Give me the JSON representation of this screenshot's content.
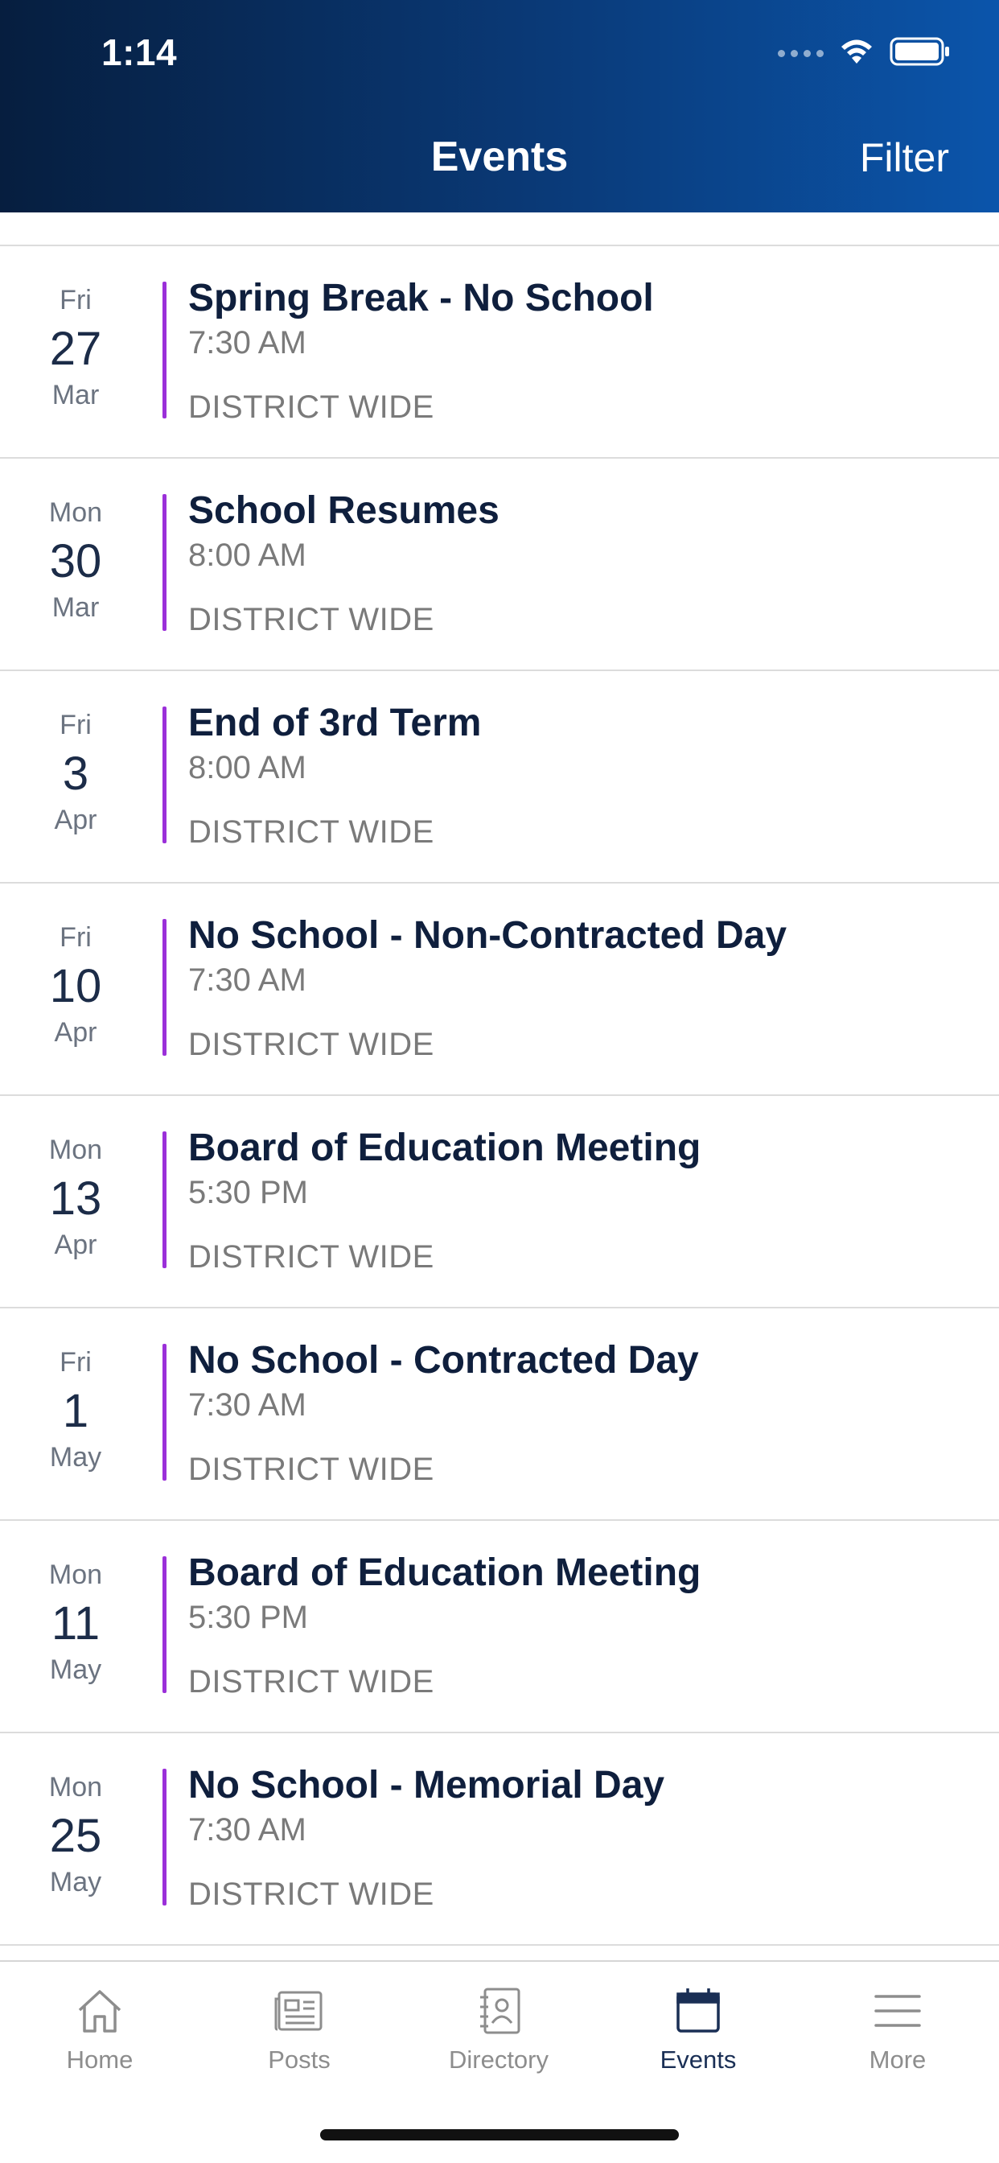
{
  "status_bar": {
    "time": "1:14"
  },
  "header": {
    "title": "Events",
    "filter_label": "Filter"
  },
  "events": [
    {
      "dow": "Fri",
      "day": "27",
      "month": "Mar",
      "title": "Spring Break - No School",
      "time": "7:30 AM",
      "location": "DISTRICT WIDE"
    },
    {
      "dow": "Mon",
      "day": "30",
      "month": "Mar",
      "title": "School Resumes",
      "time": "8:00 AM",
      "location": "DISTRICT WIDE"
    },
    {
      "dow": "Fri",
      "day": "3",
      "month": "Apr",
      "title": "End of 3rd Term",
      "time": "8:00 AM",
      "location": "DISTRICT WIDE"
    },
    {
      "dow": "Fri",
      "day": "10",
      "month": "Apr",
      "title": "No School - Non-Contracted Day",
      "time": "7:30 AM",
      "location": "DISTRICT WIDE"
    },
    {
      "dow": "Mon",
      "day": "13",
      "month": "Apr",
      "title": "Board of Education Meeting",
      "time": "5:30 PM",
      "location": "DISTRICT WIDE"
    },
    {
      "dow": "Fri",
      "day": "1",
      "month": "May",
      "title": "No School - Contracted Day",
      "time": "7:30 AM",
      "location": "DISTRICT WIDE"
    },
    {
      "dow": "Mon",
      "day": "11",
      "month": "May",
      "title": "Board of Education Meeting",
      "time": "5:30 PM",
      "location": "DISTRICT WIDE"
    },
    {
      "dow": "Mon",
      "day": "25",
      "month": "May",
      "title": "No School - Memorial Day",
      "time": "7:30 AM",
      "location": "DISTRICT WIDE"
    }
  ],
  "tab_bar": {
    "tabs": [
      {
        "label": "Home",
        "icon": "home-icon",
        "active": false
      },
      {
        "label": "Posts",
        "icon": "posts-icon",
        "active": false
      },
      {
        "label": "Directory",
        "icon": "directory-icon",
        "active": false
      },
      {
        "label": "Events",
        "icon": "calendar-icon",
        "active": true
      },
      {
        "label": "More",
        "icon": "menu-icon",
        "active": false
      }
    ]
  },
  "colors": {
    "header_dark": "#061e3f",
    "header_light": "#0b55ab",
    "accent": "#9b30d9",
    "title_text": "#0f1f3d",
    "active_tab": "#1a2f55",
    "inactive_tab": "#8d8d8d"
  }
}
